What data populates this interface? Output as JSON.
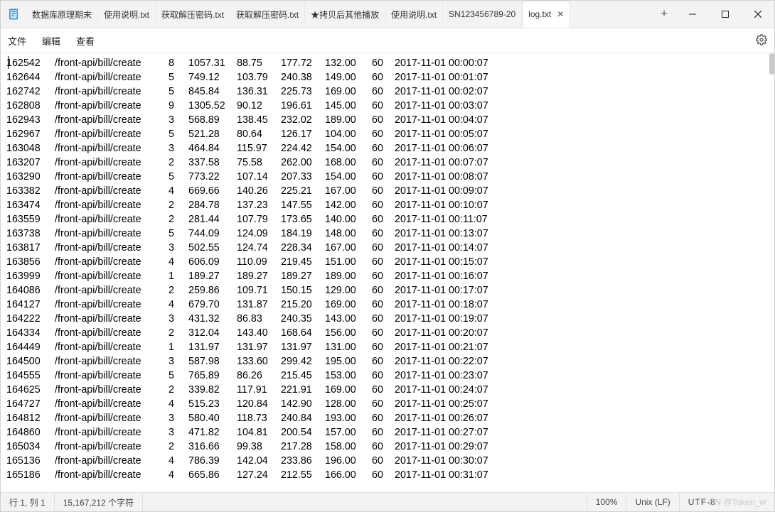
{
  "tabs": [
    {
      "label": "数据库原理期末"
    },
    {
      "label": "使用说明.txt"
    },
    {
      "label": "获取解压密码.txt"
    },
    {
      "label": "获取解压密码.txt"
    },
    {
      "label": "★拷贝后其他播放"
    },
    {
      "label": "使用说明.txt"
    },
    {
      "label": "SN123456789-20"
    },
    {
      "label": "log.txt",
      "active": true
    }
  ],
  "menu": {
    "file": "文件",
    "edit": "编辑",
    "view": "查看"
  },
  "log_rows": [
    {
      "id": "162542",
      "path": "/front-api/bill/create",
      "n": "8",
      "v1": "1057.31",
      "v2": "88.75",
      "v3": "177.72",
      "v4": "132.00",
      "v5": "60",
      "ts": "2017-11-01 00:00:07"
    },
    {
      "id": "162644",
      "path": "/front-api/bill/create",
      "n": "5",
      "v1": "749.12",
      "v2": "103.79",
      "v3": "240.38",
      "v4": "149.00",
      "v5": "60",
      "ts": "2017-11-01 00:01:07"
    },
    {
      "id": "162742",
      "path": "/front-api/bill/create",
      "n": "5",
      "v1": "845.84",
      "v2": "136.31",
      "v3": "225.73",
      "v4": "169.00",
      "v5": "60",
      "ts": "2017-11-01 00:02:07"
    },
    {
      "id": "162808",
      "path": "/front-api/bill/create",
      "n": "9",
      "v1": "1305.52",
      "v2": "90.12",
      "v3": "196.61",
      "v4": "145.00",
      "v5": "60",
      "ts": "2017-11-01 00:03:07"
    },
    {
      "id": "162943",
      "path": "/front-api/bill/create",
      "n": "3",
      "v1": "568.89",
      "v2": "138.45",
      "v3": "232.02",
      "v4": "189.00",
      "v5": "60",
      "ts": "2017-11-01 00:04:07"
    },
    {
      "id": "162967",
      "path": "/front-api/bill/create",
      "n": "5",
      "v1": "521.28",
      "v2": "80.64",
      "v3": "126.17",
      "v4": "104.00",
      "v5": "60",
      "ts": "2017-11-01 00:05:07"
    },
    {
      "id": "163048",
      "path": "/front-api/bill/create",
      "n": "3",
      "v1": "464.84",
      "v2": "115.97",
      "v3": "224.42",
      "v4": "154.00",
      "v5": "60",
      "ts": "2017-11-01 00:06:07"
    },
    {
      "id": "163207",
      "path": "/front-api/bill/create",
      "n": "2",
      "v1": "337.58",
      "v2": "75.58",
      "v3": "262.00",
      "v4": "168.00",
      "v5": "60",
      "ts": "2017-11-01 00:07:07"
    },
    {
      "id": "163290",
      "path": "/front-api/bill/create",
      "n": "5",
      "v1": "773.22",
      "v2": "107.14",
      "v3": "207.33",
      "v4": "154.00",
      "v5": "60",
      "ts": "2017-11-01 00:08:07"
    },
    {
      "id": "163382",
      "path": "/front-api/bill/create",
      "n": "4",
      "v1": "669.66",
      "v2": "140.26",
      "v3": "225.21",
      "v4": "167.00",
      "v5": "60",
      "ts": "2017-11-01 00:09:07"
    },
    {
      "id": "163474",
      "path": "/front-api/bill/create",
      "n": "2",
      "v1": "284.78",
      "v2": "137.23",
      "v3": "147.55",
      "v4": "142.00",
      "v5": "60",
      "ts": "2017-11-01 00:10:07"
    },
    {
      "id": "163559",
      "path": "/front-api/bill/create",
      "n": "2",
      "v1": "281.44",
      "v2": "107.79",
      "v3": "173.65",
      "v4": "140.00",
      "v5": "60",
      "ts": "2017-11-01 00:11:07"
    },
    {
      "id": "163738",
      "path": "/front-api/bill/create",
      "n": "5",
      "v1": "744.09",
      "v2": "124.09",
      "v3": "184.19",
      "v4": "148.00",
      "v5": "60",
      "ts": "2017-11-01 00:13:07"
    },
    {
      "id": "163817",
      "path": "/front-api/bill/create",
      "n": "3",
      "v1": "502.55",
      "v2": "124.74",
      "v3": "228.34",
      "v4": "167.00",
      "v5": "60",
      "ts": "2017-11-01 00:14:07"
    },
    {
      "id": "163856",
      "path": "/front-api/bill/create",
      "n": "4",
      "v1": "606.09",
      "v2": "110.09",
      "v3": "219.45",
      "v4": "151.00",
      "v5": "60",
      "ts": "2017-11-01 00:15:07"
    },
    {
      "id": "163999",
      "path": "/front-api/bill/create",
      "n": "1",
      "v1": "189.27",
      "v2": "189.27",
      "v3": "189.27",
      "v4": "189.00",
      "v5": "60",
      "ts": "2017-11-01 00:16:07"
    },
    {
      "id": "164086",
      "path": "/front-api/bill/create",
      "n": "2",
      "v1": "259.86",
      "v2": "109.71",
      "v3": "150.15",
      "v4": "129.00",
      "v5": "60",
      "ts": "2017-11-01 00:17:07"
    },
    {
      "id": "164127",
      "path": "/front-api/bill/create",
      "n": "4",
      "v1": "679.70",
      "v2": "131.87",
      "v3": "215.20",
      "v4": "169.00",
      "v5": "60",
      "ts": "2017-11-01 00:18:07"
    },
    {
      "id": "164222",
      "path": "/front-api/bill/create",
      "n": "3",
      "v1": "431.32",
      "v2": "86.83",
      "v3": "240.35",
      "v4": "143.00",
      "v5": "60",
      "ts": "2017-11-01 00:19:07"
    },
    {
      "id": "164334",
      "path": "/front-api/bill/create",
      "n": "2",
      "v1": "312.04",
      "v2": "143.40",
      "v3": "168.64",
      "v4": "156.00",
      "v5": "60",
      "ts": "2017-11-01 00:20:07"
    },
    {
      "id": "164449",
      "path": "/front-api/bill/create",
      "n": "1",
      "v1": "131.97",
      "v2": "131.97",
      "v3": "131.97",
      "v4": "131.00",
      "v5": "60",
      "ts": "2017-11-01 00:21:07"
    },
    {
      "id": "164500",
      "path": "/front-api/bill/create",
      "n": "3",
      "v1": "587.98",
      "v2": "133.60",
      "v3": "299.42",
      "v4": "195.00",
      "v5": "60",
      "ts": "2017-11-01 00:22:07"
    },
    {
      "id": "164555",
      "path": "/front-api/bill/create",
      "n": "5",
      "v1": "765.89",
      "v2": "86.26",
      "v3": "215.45",
      "v4": "153.00",
      "v5": "60",
      "ts": "2017-11-01 00:23:07"
    },
    {
      "id": "164625",
      "path": "/front-api/bill/create",
      "n": "2",
      "v1": "339.82",
      "v2": "117.91",
      "v3": "221.91",
      "v4": "169.00",
      "v5": "60",
      "ts": "2017-11-01 00:24:07"
    },
    {
      "id": "164727",
      "path": "/front-api/bill/create",
      "n": "4",
      "v1": "515.23",
      "v2": "120.84",
      "v3": "142.90",
      "v4": "128.00",
      "v5": "60",
      "ts": "2017-11-01 00:25:07"
    },
    {
      "id": "164812",
      "path": "/front-api/bill/create",
      "n": "3",
      "v1": "580.40",
      "v2": "118.73",
      "v3": "240.84",
      "v4": "193.00",
      "v5": "60",
      "ts": "2017-11-01 00:26:07"
    },
    {
      "id": "164860",
      "path": "/front-api/bill/create",
      "n": "3",
      "v1": "471.82",
      "v2": "104.81",
      "v3": "200.54",
      "v4": "157.00",
      "v5": "60",
      "ts": "2017-11-01 00:27:07"
    },
    {
      "id": "165034",
      "path": "/front-api/bill/create",
      "n": "2",
      "v1": "316.66",
      "v2": "99.38",
      "v3": "217.28",
      "v4": "158.00",
      "v5": "60",
      "ts": "2017-11-01 00:29:07"
    },
    {
      "id": "165136",
      "path": "/front-api/bill/create",
      "n": "4",
      "v1": "786.39",
      "v2": "142.04",
      "v3": "233.86",
      "v4": "196.00",
      "v5": "60",
      "ts": "2017-11-01 00:30:07"
    },
    {
      "id": "165186",
      "path": "/front-api/bill/create",
      "n": "4",
      "v1": "665.86",
      "v2": "127.24",
      "v3": "212.55",
      "v4": "166.00",
      "v5": "60",
      "ts": "2017-11-01 00:31:07"
    }
  ],
  "statusbar": {
    "cursor": "行 1, 列 1",
    "chars": "15,167,212 个字符",
    "zoom": "100%",
    "line_ending": "Unix (LF)",
    "encoding": "UTF-8",
    "watermark": "DN @Token_w"
  }
}
